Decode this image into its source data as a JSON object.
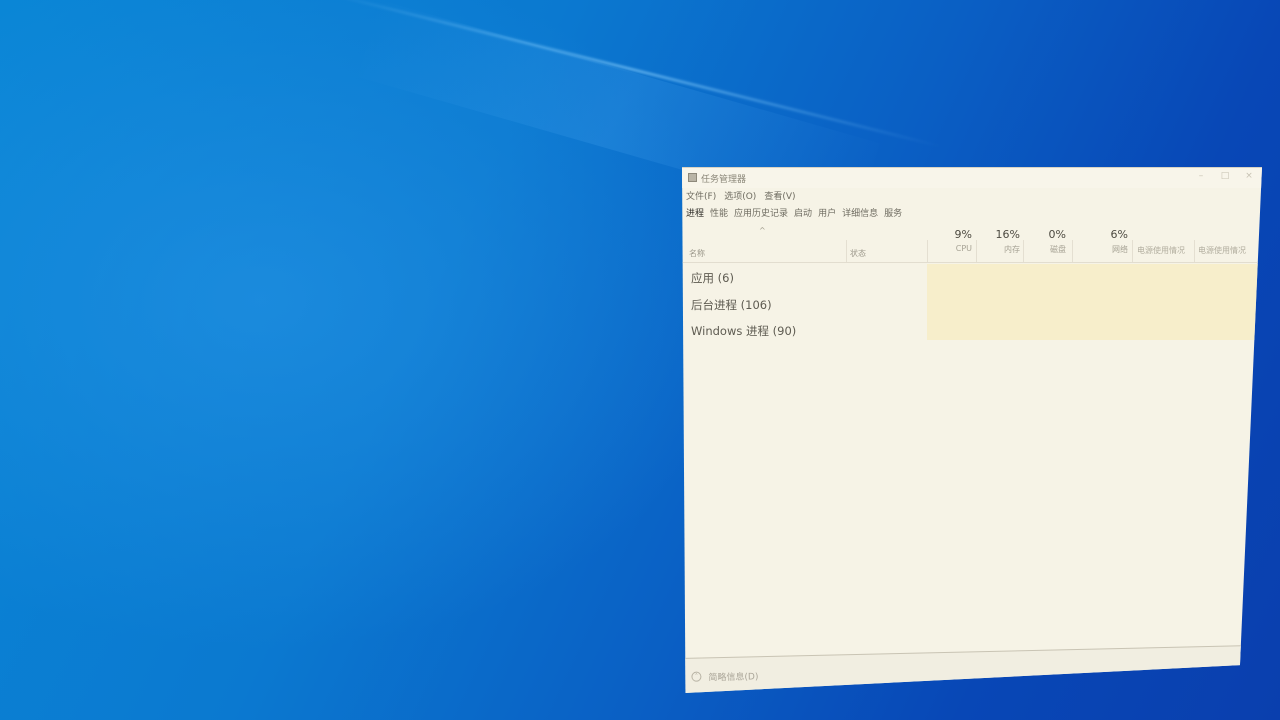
{
  "window": {
    "title": "任务管理器"
  },
  "menu": [
    "文件(F)",
    "选项(O)",
    "查看(V)"
  ],
  "tabs": [
    "进程",
    "性能",
    "应用历史记录",
    "启动",
    "用户",
    "详细信息",
    "服务"
  ],
  "columns": {
    "sort_indicator": "^",
    "name": "名称",
    "status": "状态",
    "cpu": {
      "value": "9%",
      "label": "CPU"
    },
    "memory": {
      "value": "16%",
      "label": "内存"
    },
    "disk": {
      "value": "0%",
      "label": "磁盘"
    },
    "network": {
      "value": "6%",
      "label": "网络"
    },
    "power_usage": "电源使用情况",
    "power_trend": "电源使用情况"
  },
  "groups": [
    "应用 (6)",
    "后台进程 (106)",
    "Windows 进程 (90)"
  ],
  "footer": {
    "fewer_details": "简略信息(D)"
  },
  "colors": {
    "desktop": "#0a79d0",
    "window_bg": "#f6f3e6",
    "heat": "#f7ecc6"
  }
}
